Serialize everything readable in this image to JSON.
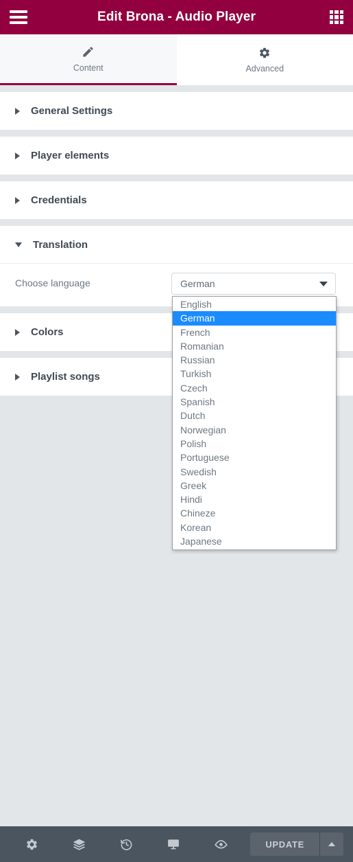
{
  "header": {
    "title": "Edit Brona - Audio Player",
    "menu_icon": "hamburger-menu-icon",
    "apps_icon": "grid-apps-icon"
  },
  "tabs": [
    {
      "label": "Content",
      "icon": "pencil-icon",
      "active": true
    },
    {
      "label": "Advanced",
      "icon": "gear-icon",
      "active": false
    }
  ],
  "sections": [
    {
      "title": "General Settings",
      "open": false
    },
    {
      "title": "Player elements",
      "open": false
    },
    {
      "title": "Credentials",
      "open": false
    },
    {
      "title": "Translation",
      "open": true
    },
    {
      "title": "Colors",
      "open": false
    },
    {
      "title": "Playlist songs",
      "open": false
    }
  ],
  "translation": {
    "field_label": "Choose language",
    "selected_value": "German",
    "options": [
      "English",
      "German",
      "French",
      "Romanian",
      "Russian",
      "Turkish",
      "Czech",
      "Spanish",
      "Dutch",
      "Norwegian",
      "Polish",
      "Portuguese",
      "Swedish",
      "Greek",
      "Hindi",
      "Chineze",
      "Korean",
      "Japanese"
    ]
  },
  "bottombar": {
    "icons": [
      "gear-icon",
      "layers-icon",
      "history-icon",
      "responsive-monitor-icon",
      "preview-eye-icon"
    ],
    "update_label": "UPDATE",
    "caret_icon": "chevron-up-icon"
  },
  "colors": {
    "brand": "#93003f",
    "bottombar": "#4b5560",
    "selection": "#1a8cff",
    "panel_bg": "#e3e6e9"
  }
}
